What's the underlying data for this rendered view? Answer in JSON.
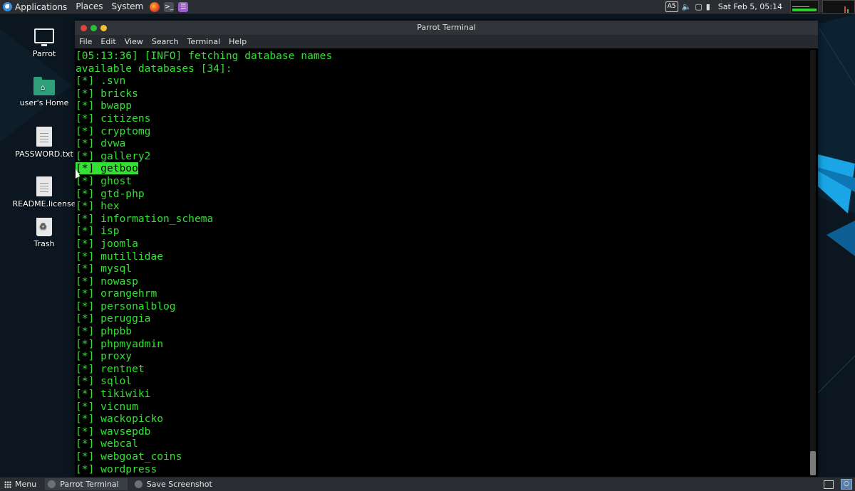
{
  "top_panel": {
    "menus": [
      "Applications",
      "Places",
      "System"
    ],
    "tray_keyboard": "A5",
    "clock": "Sat Feb 5, 05:14"
  },
  "desktop": {
    "icons": [
      {
        "label": "Parrot",
        "icon": "monitor-icon"
      },
      {
        "label": "user's Home",
        "icon": "home-folder-icon"
      },
      {
        "label": "PASSWORD.txt",
        "icon": "text-file-icon"
      },
      {
        "label": "README.license",
        "icon": "text-file-icon"
      },
      {
        "label": "Trash",
        "icon": "trash-icon"
      }
    ]
  },
  "terminal": {
    "title": "Parrot Terminal",
    "menu": [
      "File",
      "Edit",
      "View",
      "Search",
      "Terminal",
      "Help"
    ],
    "header_lines": [
      "[05:13:36] [INFO] fetching database names",
      "available databases [34]:"
    ],
    "prefix": "[*] ",
    "highlighted_index": 7,
    "databases": [
      ".svn",
      "bricks",
      "bwapp",
      "citizens",
      "cryptomg",
      "dvwa",
      "gallery2",
      "getboo",
      "ghost",
      "gtd-php",
      "hex",
      "information_schema",
      "isp",
      "joomla",
      "mutillidae",
      "mysql",
      "nowasp",
      "orangehrm",
      "personalblog",
      "peruggia",
      "phpbb",
      "phpmyadmin",
      "proxy",
      "rentnet",
      "sqlol",
      "tikiwiki",
      "vicnum",
      "wackopicko",
      "wavsepdb",
      "webcal",
      "webgoat_coins",
      "wordpress"
    ]
  },
  "taskbar": {
    "menu_label": "Menu",
    "tasks": [
      {
        "label": "Parrot Terminal",
        "active": true
      },
      {
        "label": "Save Screenshot",
        "active": false
      }
    ]
  },
  "colors": {
    "terminal_text": "#33e033",
    "panel_bg": "#2a2e33"
  }
}
